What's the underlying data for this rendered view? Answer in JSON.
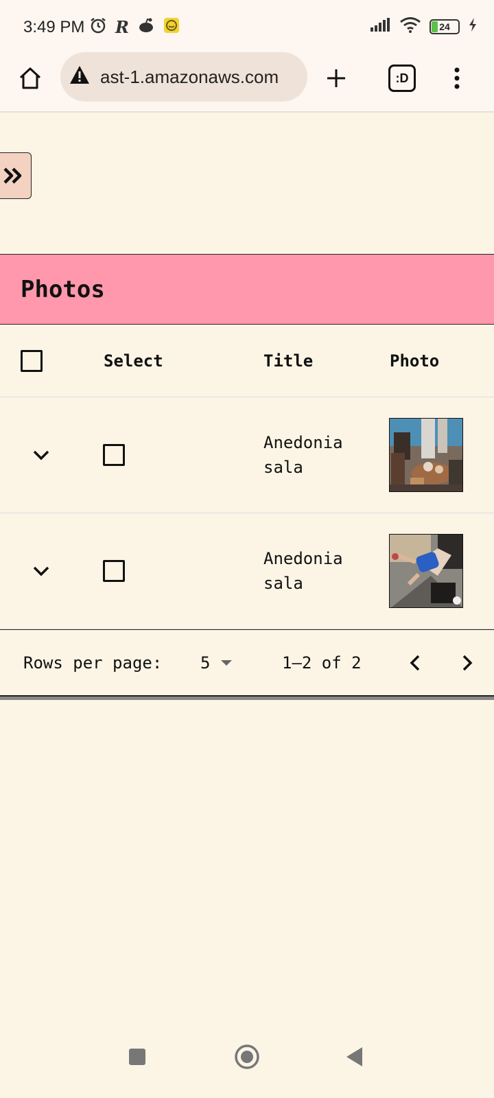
{
  "status_bar": {
    "time": "3:49 PM",
    "battery_level": "24",
    "battery_fraction": 0.24,
    "left_icons": [
      "alarm-icon",
      "r-app-icon",
      "reddit-icon",
      "chat-app-icon"
    ],
    "right_icons": [
      "signal-icon",
      "wifi-icon",
      "battery-icon",
      "charging-icon"
    ]
  },
  "browser": {
    "url": "ast-1.amazonaws.com",
    "security_icon": "warning-icon",
    "tab_count_label": ":D"
  },
  "table": {
    "title": "Photos",
    "columns": [
      "Select",
      "Title",
      "Photo"
    ],
    "rows": [
      {
        "title": "Anedonia sala",
        "photo": "photo-thumbnail"
      },
      {
        "title": "Anedonia sala",
        "photo": "photo-thumbnail"
      }
    ],
    "pagination": {
      "rows_per_page_label": "Rows per page:",
      "rows_per_page_value": "5",
      "range": "1–2 of 2"
    }
  },
  "colors": {
    "background": "#fcf5e6",
    "header_bar": "#ff98ac",
    "drawer_toggle": "#f3d2c2",
    "status_bar": "#fdf6f1"
  }
}
